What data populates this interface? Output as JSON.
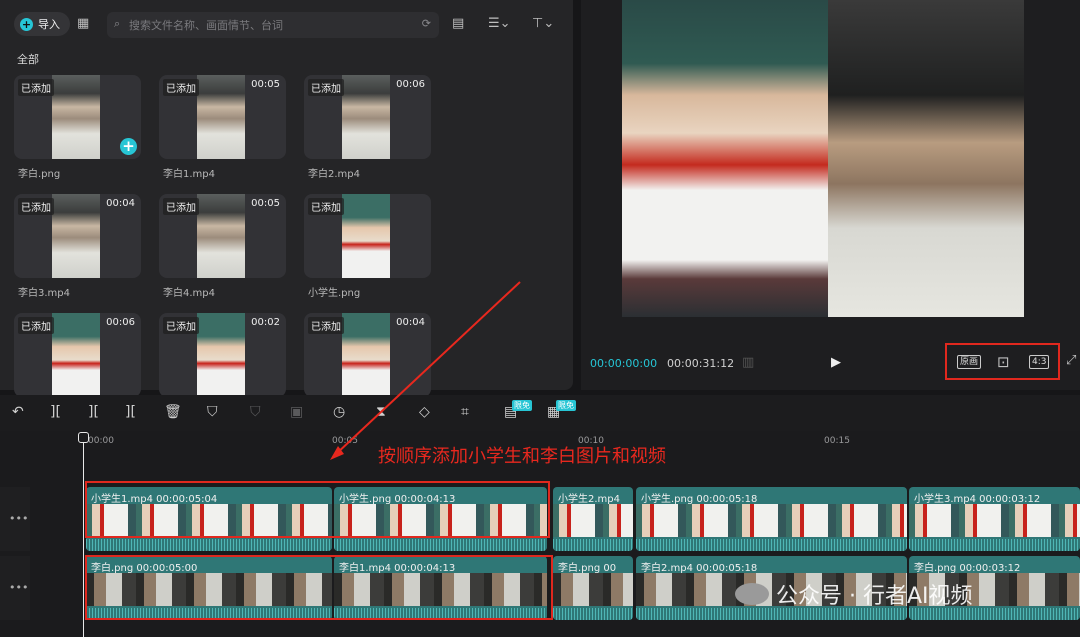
{
  "media_panel": {
    "import_label": "导入",
    "search_placeholder": "搜索文件名称、画面情节、台词",
    "section_label": "全部",
    "items": [
      {
        "badge": "已添加",
        "duration": "",
        "caption": "李白.png",
        "thumb": "li"
      },
      {
        "badge": "已添加",
        "duration": "00:05",
        "caption": "李白1.mp4",
        "thumb": "li"
      },
      {
        "badge": "已添加",
        "duration": "00:06",
        "caption": "李白2.mp4",
        "thumb": "li"
      },
      {
        "badge": "已添加",
        "duration": "00:04",
        "caption": "李白3.mp4",
        "thumb": "li"
      },
      {
        "badge": "已添加",
        "duration": "00:05",
        "caption": "李白4.mp4",
        "thumb": "li"
      },
      {
        "badge": "已添加",
        "duration": "",
        "caption": "小学生.png",
        "thumb": "gi"
      },
      {
        "badge": "已添加",
        "duration": "00:06",
        "caption": "",
        "thumb": "gi"
      },
      {
        "badge": "已添加",
        "duration": "00:02",
        "caption": "",
        "thumb": "gi"
      },
      {
        "badge": "已添加",
        "duration": "00:04",
        "caption": "",
        "thumb": "gi"
      }
    ]
  },
  "preview": {
    "current_time": "00:00:00:00",
    "total_time": "00:00:31:12",
    "btn_original": "原画",
    "btn_ratio": "4:3"
  },
  "toolbar": {
    "free_badge_1": "限免",
    "free_badge_2": "限免"
  },
  "timeline": {
    "ruler": [
      "00:00",
      "00:05",
      "00:10",
      "00:15"
    ],
    "annotation": "按顺序添加小学生和李白图片和视频",
    "track1": [
      {
        "label": "小学生1.mp4  00:00:05:04"
      },
      {
        "label": "小学生.png  00:00:04:13"
      },
      {
        "label": "小学生2.mp4"
      },
      {
        "label": "小学生.png  00:00:05:18"
      },
      {
        "label": "小学生3.mp4  00:00:03:12"
      }
    ],
    "track2": [
      {
        "label": "李白.png  00:00:05:00"
      },
      {
        "label": "李白1.mp4  00:00:04:13"
      },
      {
        "label": "李白.png  00"
      },
      {
        "label": "李白2.mp4  00:00:05:18"
      },
      {
        "label": "李白.png  00:00:03:12"
      }
    ]
  },
  "watermark": "公众号 · 行者AI视频",
  "colors": {
    "accent": "#26c6d6",
    "clip": "#2f7776",
    "annotation": "#e8281e"
  }
}
